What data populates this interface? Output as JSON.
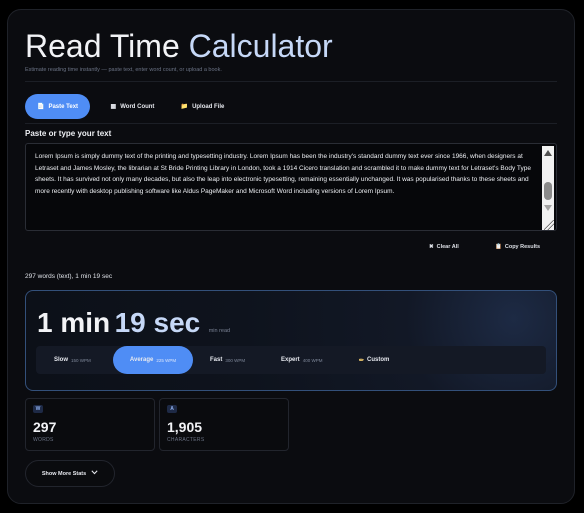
{
  "header": {
    "title_part1": "Read Time ",
    "title_part2": "Calculator",
    "subtitle": "Estimate reading time instantly — paste text, enter word count, or upload a book."
  },
  "tabs": [
    {
      "label": "Paste Text",
      "icon": "document-icon",
      "active": true
    },
    {
      "label": "Word Count",
      "icon": "grid-icon",
      "active": false
    },
    {
      "label": "Upload File",
      "icon": "folder-icon",
      "active": false
    }
  ],
  "input": {
    "label": "Paste or type your text",
    "value": "Lorem Ipsum is simply dummy text of the printing and typesetting industry. Lorem Ipsum has been the industry's standard dummy text ever since 1966, when designers at Letraset and James Mosley, the librarian at St Bride Printing Library in London, took a 1914 Cicero translation and scrambled it to make dummy text for Letraset's Body Type sheets. It has survived not only many decades, but also the leap into electronic typesetting, remaining essentially unchanged. It was popularised thanks to these sheets and more recently with desktop publishing software like Aldus PageMaker and Microsoft Word including versions of Lorem Ipsum."
  },
  "actions": {
    "clear_label": "Clear All",
    "copy_label": "Copy Results"
  },
  "summary_line": "297 words (text), 1 min 19 sec",
  "result": {
    "minutes": "1 min",
    "seconds": "19 sec",
    "unit": "min read"
  },
  "speeds": [
    {
      "label": "Slow",
      "wpm": "150 WPM",
      "active": false
    },
    {
      "label": "Average",
      "wpm": "225 WPM",
      "active": true
    },
    {
      "label": "Fast",
      "wpm": "300 WPM",
      "active": false
    },
    {
      "label": "Expert",
      "wpm": "400 WPM",
      "active": false
    },
    {
      "label": "Custom",
      "wpm": "",
      "active": false
    }
  ],
  "stats": [
    {
      "badge": "W",
      "value": "297",
      "caption": "WORDS"
    },
    {
      "badge": "A",
      "value": "1,905",
      "caption": "CHARACTERS"
    }
  ],
  "more_button": "Show More Stats",
  "colors": {
    "accent": "#4f8df5",
    "title_accent": "#c6d8f7",
    "background": "#0b0c10"
  }
}
